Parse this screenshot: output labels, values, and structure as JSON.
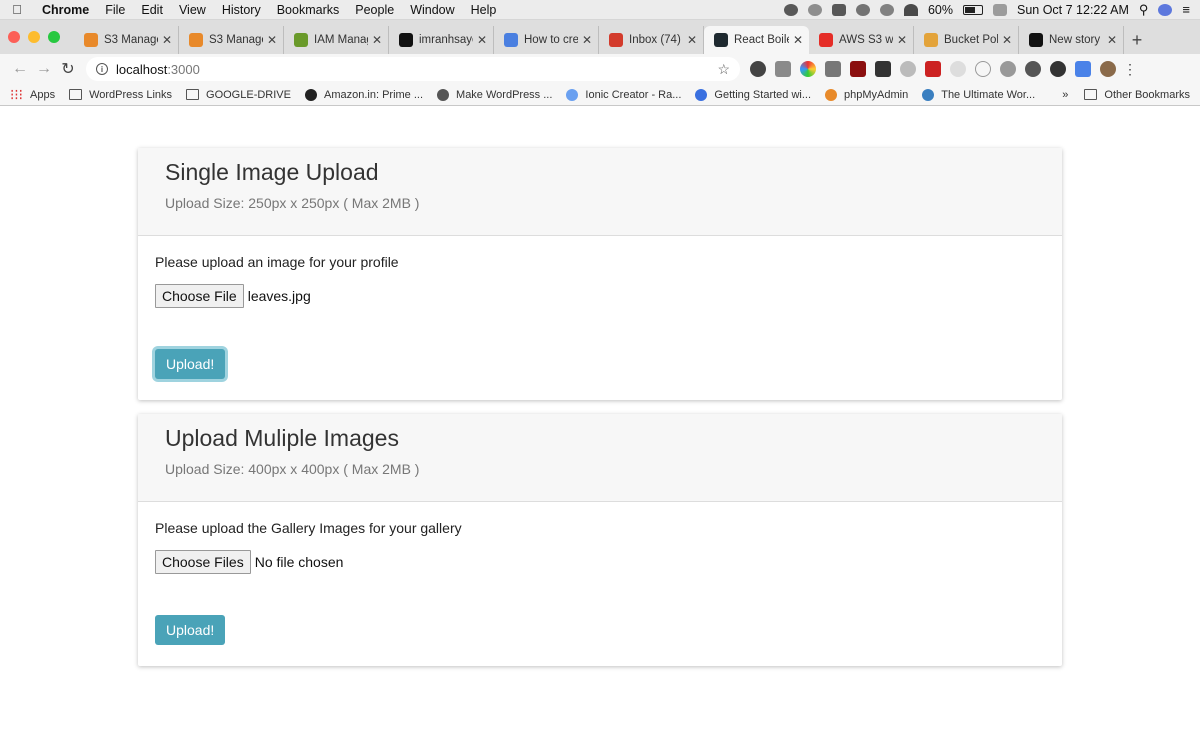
{
  "menubar": {
    "app": "Chrome",
    "items": [
      "File",
      "Edit",
      "View",
      "History",
      "Bookmarks",
      "People",
      "Window",
      "Help"
    ],
    "battery": "60%",
    "datetime": "Sun Oct 7  12:22 AM",
    "battery_level": 0.6
  },
  "tabs": [
    {
      "label": "S3 Manage",
      "icon_color": "#e8892a",
      "icon": "aws-box-icon"
    },
    {
      "label": "S3 Manage",
      "icon_color": "#e8892a",
      "icon": "aws-box-icon"
    },
    {
      "label": "IAM Manag",
      "icon_color": "#6a9a2a",
      "icon": "iam-key-icon"
    },
    {
      "label": "imranhsaye",
      "icon_color": "#111111",
      "icon": "github-icon"
    },
    {
      "label": "How to cre",
      "icon_color": "#4a7fe0",
      "icon": "docs-icon"
    },
    {
      "label": "Inbox (74)",
      "icon_color": "#d33b2c",
      "icon": "gmail-icon"
    },
    {
      "label": "React Boile",
      "icon_color": "#1f2a30",
      "icon": "react-icon",
      "active": true
    },
    {
      "label": "AWS S3 wi",
      "icon_color": "#e52d27",
      "icon": "youtube-icon"
    },
    {
      "label": "Bucket Pol",
      "icon_color": "#e3a33a",
      "icon": "bucket-icon"
    },
    {
      "label": "New story",
      "icon_color": "#111111",
      "icon": "medium-icon"
    }
  ],
  "toolbar": {
    "url_host": "localhost",
    "url_port": ":3000"
  },
  "bookmarks": {
    "items": [
      {
        "label": "Apps",
        "icon": "apps-grid-icon"
      },
      {
        "label": "WordPress Links",
        "icon": "folder-icon"
      },
      {
        "label": "GOOGLE-DRIVE",
        "icon": "folder-icon"
      },
      {
        "label": "Amazon.in: Prime ...",
        "icon": "amazon-icon"
      },
      {
        "label": "Make WordPress ...",
        "icon": "wordpress-icon"
      },
      {
        "label": "Ionic Creator - Ra...",
        "icon": "ionic-icon"
      },
      {
        "label": "Getting Started wi...",
        "icon": "chrome-icon"
      },
      {
        "label": "phpMyAdmin",
        "icon": "phpmyadmin-icon"
      },
      {
        "label": "The Ultimate Wor...",
        "icon": "tuw-icon"
      }
    ],
    "overflow": "»",
    "other": "Other Bookmarks"
  },
  "single": {
    "title": "Single Image Upload",
    "subtitle": "Upload Size: 250px x 250px ( Max 2MB )",
    "prompt": "Please upload an image for your profile",
    "choose_label": "Choose File",
    "file_status": "leaves.jpg",
    "upload_label": "Upload!"
  },
  "multiple": {
    "title": "Upload Muliple Images",
    "subtitle": "Upload Size: 400px x 400px ( Max 2MB )",
    "prompt": "Please upload the Gallery Images for your gallery",
    "choose_label": "Choose Files",
    "file_status": "No file chosen",
    "upload_label": "Upload!"
  }
}
